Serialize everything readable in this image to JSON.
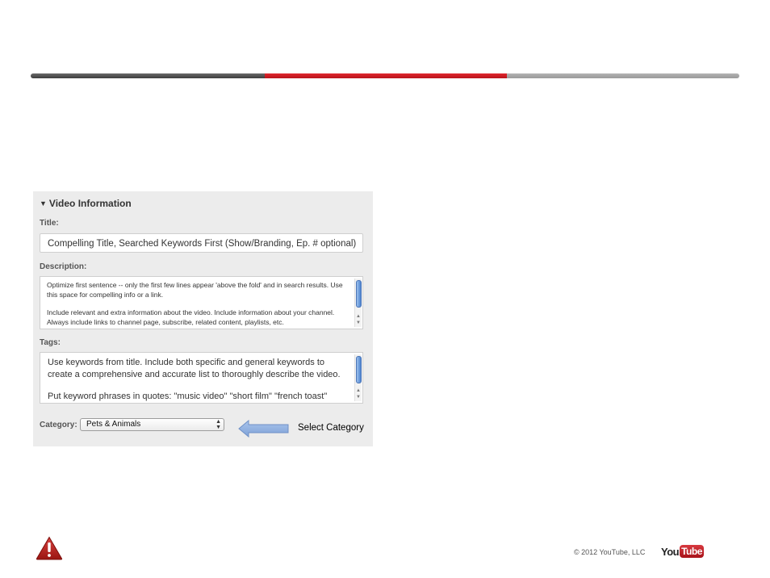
{
  "progress_bar": {
    "colors": {
      "past": "#4a4a4a",
      "current": "#cc1f26",
      "upcoming": "#a4a4a4"
    }
  },
  "video_info": {
    "section_title": "Video Information",
    "title_label": "Title:",
    "title_value": "Compelling Title, Searched Keywords First (Show/Branding, Ep. # optional)",
    "description_label": "Description:",
    "description_paragraphs": [
      "Optimize first sentence -- only the first few lines appear 'above the fold' and in search results.  Use this space for compelling info or a link.",
      "Include relevant and extra information about the video. Include information about your channel. Always include links to channel page, subscribe, related content, playlists, etc."
    ],
    "tags_label": "Tags:",
    "tags_paragraphs": [
      "Use keywords from title.  Include both specific and general keywords to create a comprehensive and accurate list to thoroughly describe the video.",
      "Put keyword phrases in quotes: \"music video\" \"short film\" \"french toast\""
    ],
    "category_label": "Category:",
    "category_value": "Pets & Animals"
  },
  "callout": {
    "text": "Select Category"
  },
  "footer": {
    "copyright": "© 2012 YouTube, LLC",
    "logo_you": "You",
    "logo_tube": "Tube",
    "warning_icon": "warning-triangle-icon"
  }
}
